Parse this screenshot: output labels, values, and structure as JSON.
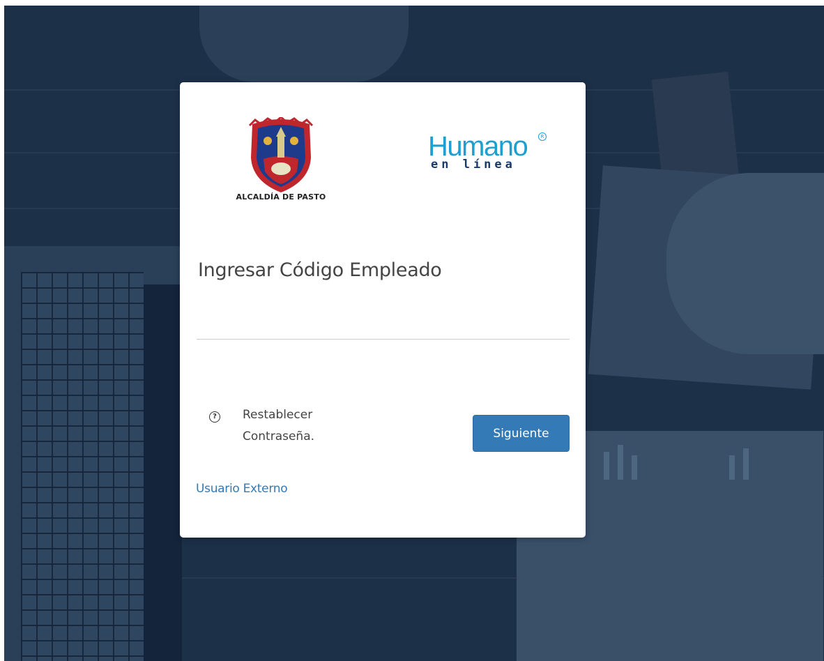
{
  "background": {
    "description_icon": "office-desk-background-image"
  },
  "logos": {
    "alcaldia_text": "ALCALDÍA DE PASTO",
    "humano_word": "Humano",
    "humano_sub": "en línea",
    "humano_reg": "R"
  },
  "login": {
    "title": "Ingresar Código Empleado",
    "code_value": "",
    "code_placeholder": "",
    "reset_line1": "Restablecer",
    "reset_line2": "Contraseña.",
    "help_glyph": "?",
    "next_label": "Siguiente",
    "external_user_label": "Usuario Externo"
  },
  "colors": {
    "primary": "#337ab7",
    "humano_blue": "#1e9fcf",
    "humano_navy": "#1a3a6a",
    "background_overlay": "#1c3048"
  }
}
